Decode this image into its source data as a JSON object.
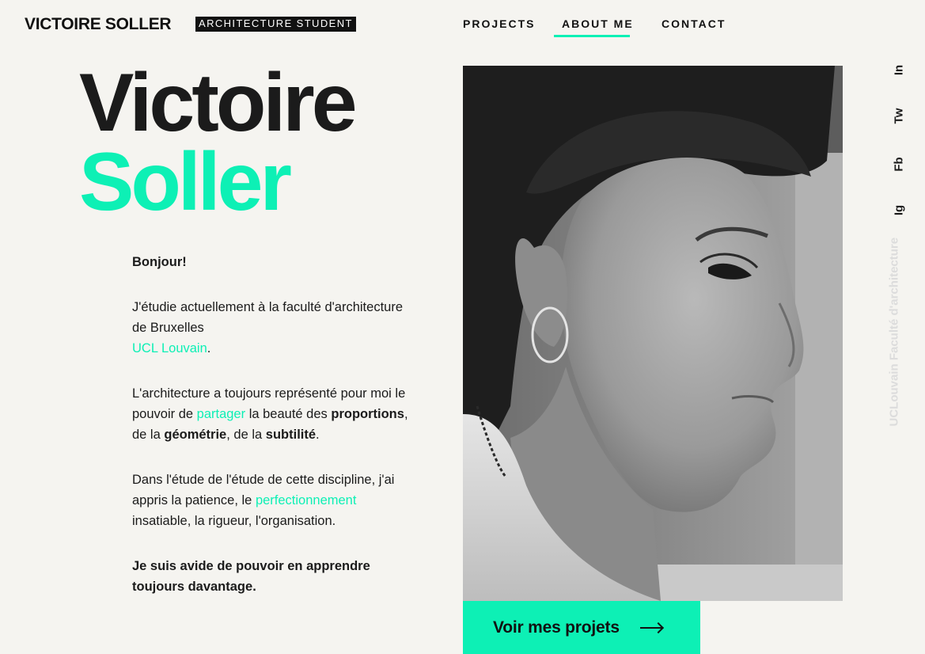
{
  "header": {
    "logo": "VICTOIRE SOLLER",
    "tag": "ARCHITECTURE STUDENT",
    "nav": [
      {
        "label": "PROJECTS"
      },
      {
        "label": "ABOUT ME",
        "active": true
      },
      {
        "label": "CONTACT"
      }
    ]
  },
  "hero": {
    "first_name": "Victoire",
    "last_name": "Soller"
  },
  "bio": {
    "greeting": "Bonjour!",
    "p1_text": "J'étudie actuellement à la faculté d'architecture de Bruxelles",
    "p1_link": "UCL Louvain",
    "p1_end": ".",
    "p2_a": "L'architecture a toujours représenté pour moi le pouvoir de ",
    "p2_link": "partager",
    "p2_b": " la beauté des ",
    "p2_bold1": "proportions",
    "p2_c": ", de la ",
    "p2_bold2": "géométrie",
    "p2_d": ", de la ",
    "p2_bold3": "subtilité",
    "p2_e": ".",
    "p3_a": "Dans l'étude de l'étude de cette discipline, j'ai appris la patience, le ",
    "p3_link": "perfectionnement",
    "p3_b": " insatiable, la rigueur, l'organisation.",
    "closing": "Je suis avide de pouvoir en apprendre toujours davantage."
  },
  "cta": {
    "label": "Voir mes projets"
  },
  "social": {
    "in": "In",
    "tw": "Tw",
    "fb": "Fb",
    "ig": "Ig"
  },
  "side_label": "UCLouvain Faculté d'architecture",
  "colors": {
    "accent": "#0df0b5",
    "background": "#f5f4f0",
    "text": "#1b1b1b"
  }
}
